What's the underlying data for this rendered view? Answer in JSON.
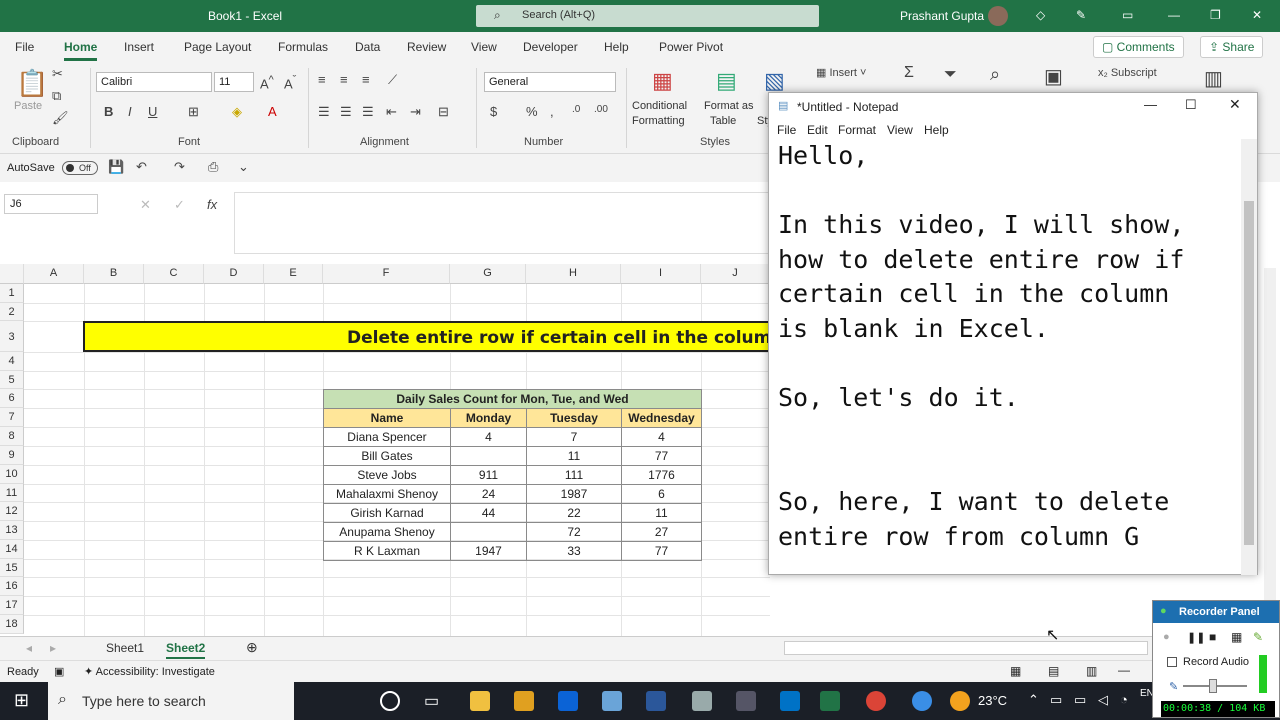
{
  "titlebar": {
    "title": "Book1  -  Excel",
    "search_placeholder": "Search (Alt+Q)",
    "user": "Prashant Gupta"
  },
  "menubar": {
    "items": [
      "File",
      "Home",
      "Insert",
      "Page Layout",
      "Formulas",
      "Data",
      "Review",
      "View",
      "Developer",
      "Help",
      "Power Pivot"
    ],
    "comments": "Comments",
    "share": "Share"
  },
  "ribbon": {
    "clipboard": {
      "paste": "Paste",
      "group": "Clipboard"
    },
    "font": {
      "name": "Calibri",
      "size": "11",
      "group": "Font"
    },
    "alignment": {
      "group": "Alignment"
    },
    "number": {
      "format": "General",
      "group": "Number"
    },
    "styles": {
      "conditional": "Conditional",
      "formatting": "Formatting",
      "format_as": "Format as",
      "table": "Table",
      "st": "Sty",
      "group": "Styles"
    },
    "cells": {
      "insert": "Insert"
    },
    "editing": {
      "subscript": "Subscript"
    }
  },
  "qab": {
    "autosave": "AutoSave",
    "toggle": "Off"
  },
  "formula": {
    "namebox": "J6",
    "x": "✕",
    "check": "✓",
    "fx": "fx"
  },
  "grid": {
    "columns": [
      "A",
      "B",
      "C",
      "D",
      "E",
      "F",
      "G",
      "H",
      "I",
      "J"
    ],
    "rows": [
      "1",
      "2",
      "3",
      "4",
      "5",
      "6",
      "7",
      "8",
      "9",
      "10",
      "11",
      "12",
      "13",
      "14",
      "15",
      "16",
      "17",
      "18"
    ],
    "banner": "Delete entire row if certain cell in the column",
    "table_title": "Daily Sales Count for Mon, Tue, and Wed",
    "headers": [
      "Name",
      "Monday",
      "Tuesday",
      "Wednesday"
    ],
    "data": [
      [
        "Diana Spencer",
        "4",
        "7",
        "4"
      ],
      [
        "Bill Gates",
        "",
        "11",
        "77"
      ],
      [
        "Steve Jobs",
        "911",
        "111",
        "1776"
      ],
      [
        "Mahalaxmi Shenoy",
        "24",
        "1987",
        "6"
      ],
      [
        "Girish Karnad",
        "44",
        "22",
        "11"
      ],
      [
        "Anupama Shenoy",
        "",
        "72",
        "27"
      ],
      [
        "R K Laxman",
        "1947",
        "33",
        "77"
      ]
    ]
  },
  "sheets": {
    "tabs": [
      "Sheet1",
      "Sheet2"
    ],
    "active": "Sheet2"
  },
  "status": {
    "ready": "Ready",
    "accessibility": "Accessibility: Investigate"
  },
  "notepad": {
    "title": "*Untitled - Notepad",
    "menu": [
      "File",
      "Edit",
      "Format",
      "View",
      "Help"
    ],
    "text": "Hello,\n\nIn this video, I will show,\nhow to delete entire row if\ncertain cell in the column\nis blank in Excel.\n\nSo, let's do it.\n\n\nSo, here, I want to delete\nentire row from column G"
  },
  "recorder": {
    "title": "Recorder Panel",
    "record_audio": "Record Audio",
    "time": "00:00:38 / 104 KB"
  },
  "taskbar": {
    "search": "Type here to search",
    "temp": "23°C",
    "lang": "EN"
  }
}
